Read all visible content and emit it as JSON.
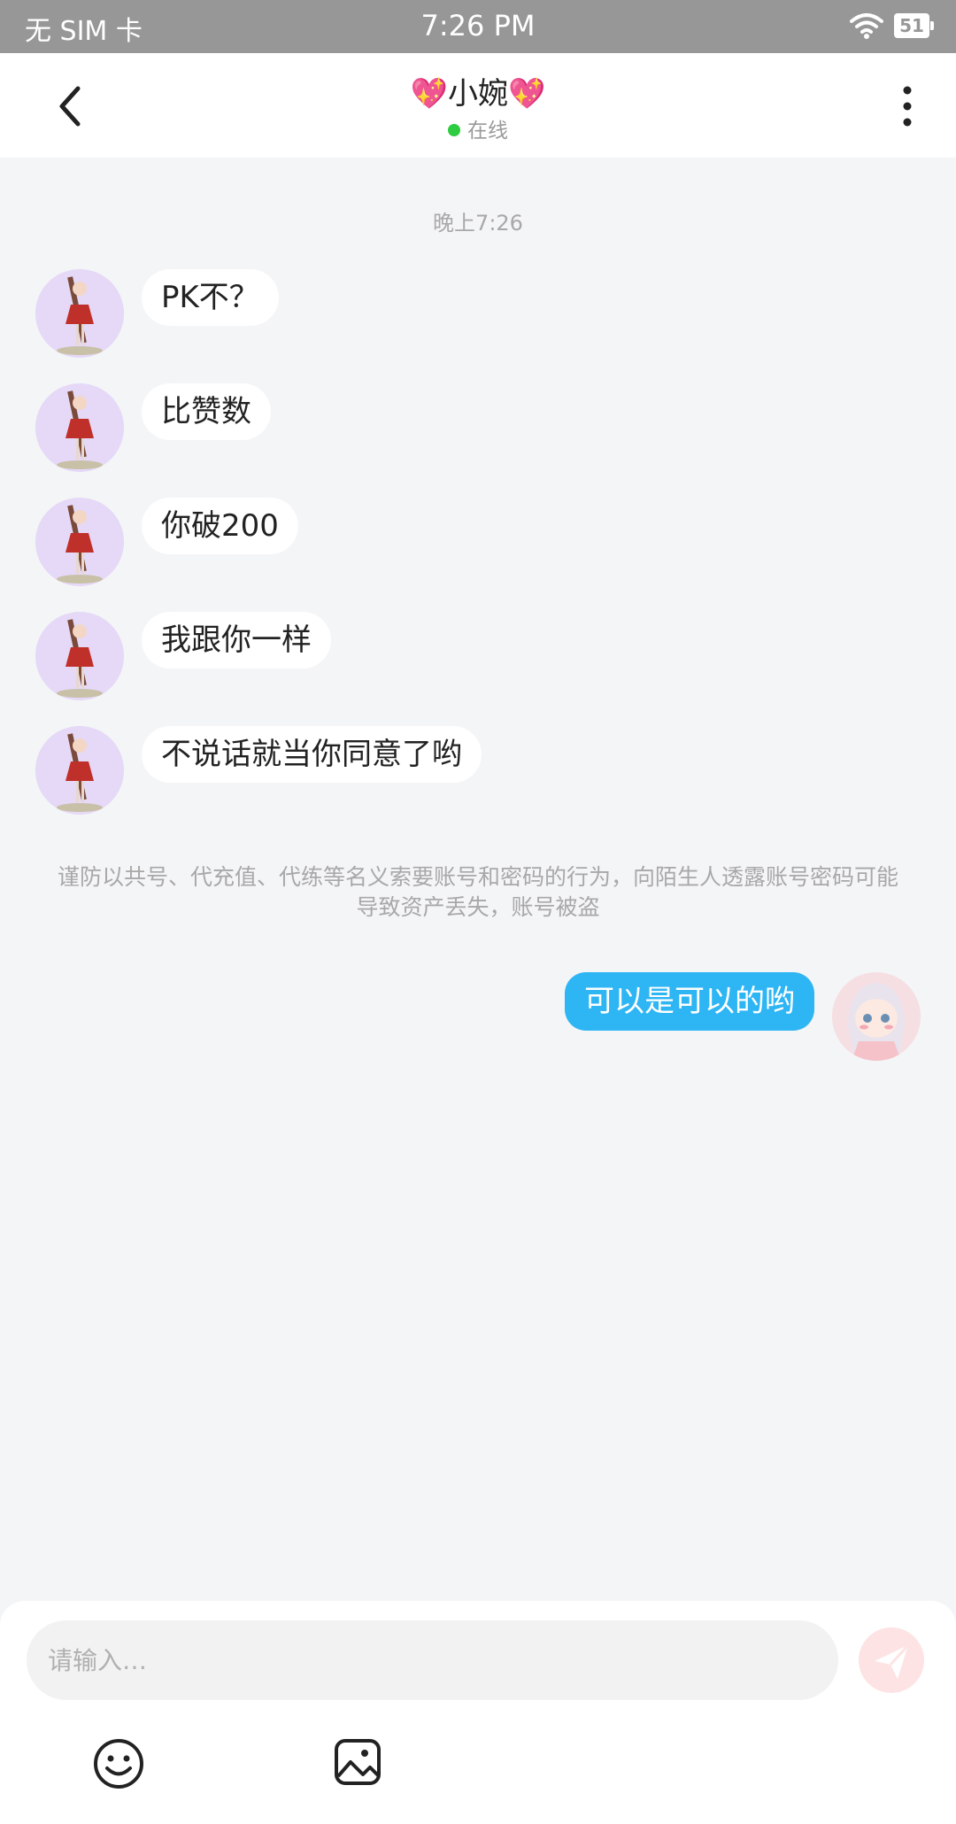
{
  "status_bar": {
    "carrier": "无 SIM 卡",
    "time": "7:26 PM",
    "battery": "51"
  },
  "header": {
    "title": "小婉",
    "title_decoration": "💖",
    "status": "在线",
    "status_color": "#2ecc40"
  },
  "chat": {
    "timestamp": "晚上7:26",
    "incoming": [
      {
        "text": "PK不？"
      },
      {
        "text": "比赞数"
      },
      {
        "text": "你破200"
      },
      {
        "text": "我跟你一样"
      },
      {
        "text": "不说话就当你同意了哟"
      }
    ],
    "warning": "谨防以共号、代充值、代练等名义索要账号和密码的行为，向陌生人透露账号密码可能导致资产丢失，账号被盗",
    "outgoing": [
      {
        "text": "可以是可以的哟"
      }
    ]
  },
  "composer": {
    "placeholder": "请输入…",
    "icons": [
      "emoji-icon",
      "image-icon",
      "send-icon"
    ]
  },
  "colors": {
    "accent": "#2db5f4",
    "background": "#f4f5f7",
    "status_bar": "#979797"
  }
}
